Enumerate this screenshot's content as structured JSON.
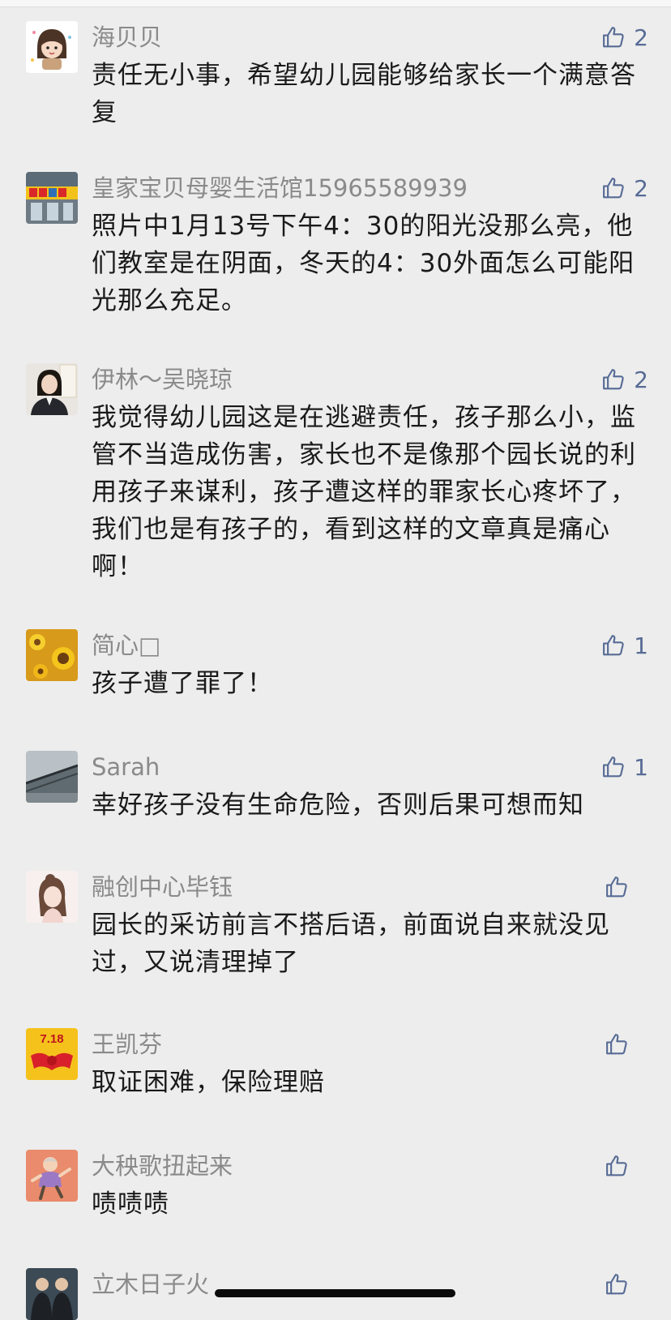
{
  "comments": [
    {
      "name": "海贝贝",
      "text": "责任无小事，希望幼儿园能够给家长一个满意答复",
      "likes": "2",
      "avatar": "cartoon-girl-avatar"
    },
    {
      "name": "皇家宝贝母婴生活馆15965589939",
      "text": "照片中1月13号下午4：30的阳光没那么亮，他们教室是在阴面，冬天的4：30外面怎么可能阳光那么充足。",
      "likes": "2",
      "avatar": "shopfront-avatar"
    },
    {
      "name": "伊林～吴晓琼",
      "text": "我觉得幼儿园这是在逃避责任，孩子那么小，监管不当造成伤害，家长也不是像那个园长说的利用孩子来谋利，孩子遭这样的罪家长心疼坏了，我们也是有孩子的，看到这样的文章真是痛心啊！",
      "likes": "2",
      "avatar": "woman-photo-avatar"
    },
    {
      "name": "简心□",
      "text": "孩子遭了罪了！",
      "likes": "1",
      "avatar": "sunflower-avatar"
    },
    {
      "name": "Sarah",
      "text": "幸好孩子没有生命危险，否则后果可想而知",
      "likes": "1",
      "avatar": "bridge-photo-avatar"
    },
    {
      "name": "融创中心毕钰",
      "text": "园长的采访前言不搭后语，前面说自来就没见过，又说清理掉了",
      "likes": "",
      "avatar": "illustrated-girl-avatar"
    },
    {
      "name": "王凯芬",
      "text": "取证困难，保险理赔",
      "likes": "",
      "avatar": "718-ribbon-avatar"
    },
    {
      "name": "大秧歌扭起来",
      "text": "啧啧啧",
      "likes": "",
      "avatar": "dancing-grandma-avatar"
    },
    {
      "name": "立木日子火",
      "text": "",
      "likes": "",
      "avatar": "two-men-photo-avatar"
    }
  ],
  "avatar_texts": {
    "ribbon_date": "7.18"
  },
  "colors": {
    "background": "#ededed",
    "name": "#8a8a8a",
    "text": "#1a1a1a",
    "like_icon": "#576b95",
    "home_indicator": "#0b0b0b"
  },
  "icons": {
    "like": "thumbs-up-icon"
  }
}
